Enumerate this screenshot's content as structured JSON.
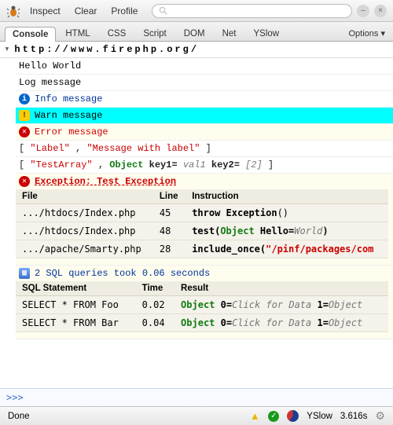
{
  "toolbar": {
    "inspect": "Inspect",
    "clear": "Clear",
    "profile": "Profile",
    "search_placeholder": ""
  },
  "tabs": {
    "items": [
      "Console",
      "HTML",
      "CSS",
      "Script",
      "DOM",
      "Net",
      "YSlow"
    ],
    "options": "Options ▾"
  },
  "url": "http://www.firephp.org/",
  "logs": {
    "hello": "Hello World",
    "plain": "Log message",
    "info": "Info message",
    "warn": "Warn message",
    "error": "Error message",
    "label_open": "[ ",
    "label_key": "\"Label\"",
    "label_sep": ", ",
    "label_val": "\"Message with label\"",
    "label_close": " ]",
    "ta_key": "\"TestArray\"",
    "ta_obj": "Object",
    "ta_k1": " key1=",
    "ta_v1": "val1",
    "ta_k2": " key2=",
    "ta_v2": "[2]",
    "exception": "Exception: Test Exception",
    "trace": {
      "headers": [
        "File",
        "Line",
        "Instruction"
      ],
      "rows": [
        {
          "file": ".../htdocs/Index.php",
          "line": "45",
          "instr_head": "throw Exception",
          "instr_rest": "()"
        },
        {
          "file": ".../htdocs/Index.php",
          "line": "48",
          "instr_head": "test(",
          "obj": "Object",
          "k": " Hello=",
          "v": "World",
          "tail": ")"
        },
        {
          "file": ".../apache/Smarty.php",
          "line": "28",
          "instr_head": "include_once(",
          "path": "\"/pinf/packages/com"
        }
      ]
    },
    "sql": {
      "title": "2 SQL queries took 0.06 seconds",
      "headers": [
        "SQL Statement",
        "Time",
        "Result"
      ],
      "rows": [
        {
          "stmt": "SELECT * FROM Foo",
          "time": "0.02",
          "obj": "Object",
          "r": " 0=",
          "rv": "Click for Data",
          "r2": " 1=",
          "rv2": "Object"
        },
        {
          "stmt": "SELECT * FROM Bar",
          "time": "0.04",
          "obj": "Object",
          "r": " 0=",
          "rv": "Click for Data",
          "r2": " 1=",
          "rv2": "Object"
        }
      ]
    }
  },
  "prompt": ">>>",
  "status": {
    "done": "Done",
    "yslow": "YSlow",
    "time": "3.616s"
  }
}
